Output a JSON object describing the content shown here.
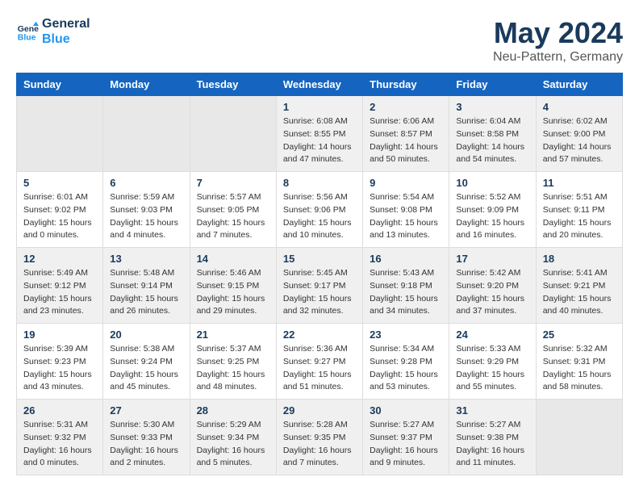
{
  "logo": {
    "line1": "General",
    "line2": "Blue"
  },
  "title": "May 2024",
  "location": "Neu-Pattern, Germany",
  "weekdays": [
    "Sunday",
    "Monday",
    "Tuesday",
    "Wednesday",
    "Thursday",
    "Friday",
    "Saturday"
  ],
  "weeks": [
    [
      {
        "day": "",
        "sunrise": "",
        "sunset": "",
        "daylight": ""
      },
      {
        "day": "",
        "sunrise": "",
        "sunset": "",
        "daylight": ""
      },
      {
        "day": "",
        "sunrise": "",
        "sunset": "",
        "daylight": ""
      },
      {
        "day": "1",
        "sunrise": "Sunrise: 6:08 AM",
        "sunset": "Sunset: 8:55 PM",
        "daylight": "Daylight: 14 hours and 47 minutes."
      },
      {
        "day": "2",
        "sunrise": "Sunrise: 6:06 AM",
        "sunset": "Sunset: 8:57 PM",
        "daylight": "Daylight: 14 hours and 50 minutes."
      },
      {
        "day": "3",
        "sunrise": "Sunrise: 6:04 AM",
        "sunset": "Sunset: 8:58 PM",
        "daylight": "Daylight: 14 hours and 54 minutes."
      },
      {
        "day": "4",
        "sunrise": "Sunrise: 6:02 AM",
        "sunset": "Sunset: 9:00 PM",
        "daylight": "Daylight: 14 hours and 57 minutes."
      }
    ],
    [
      {
        "day": "5",
        "sunrise": "Sunrise: 6:01 AM",
        "sunset": "Sunset: 9:02 PM",
        "daylight": "Daylight: 15 hours and 0 minutes."
      },
      {
        "day": "6",
        "sunrise": "Sunrise: 5:59 AM",
        "sunset": "Sunset: 9:03 PM",
        "daylight": "Daylight: 15 hours and 4 minutes."
      },
      {
        "day": "7",
        "sunrise": "Sunrise: 5:57 AM",
        "sunset": "Sunset: 9:05 PM",
        "daylight": "Daylight: 15 hours and 7 minutes."
      },
      {
        "day": "8",
        "sunrise": "Sunrise: 5:56 AM",
        "sunset": "Sunset: 9:06 PM",
        "daylight": "Daylight: 15 hours and 10 minutes."
      },
      {
        "day": "9",
        "sunrise": "Sunrise: 5:54 AM",
        "sunset": "Sunset: 9:08 PM",
        "daylight": "Daylight: 15 hours and 13 minutes."
      },
      {
        "day": "10",
        "sunrise": "Sunrise: 5:52 AM",
        "sunset": "Sunset: 9:09 PM",
        "daylight": "Daylight: 15 hours and 16 minutes."
      },
      {
        "day": "11",
        "sunrise": "Sunrise: 5:51 AM",
        "sunset": "Sunset: 9:11 PM",
        "daylight": "Daylight: 15 hours and 20 minutes."
      }
    ],
    [
      {
        "day": "12",
        "sunrise": "Sunrise: 5:49 AM",
        "sunset": "Sunset: 9:12 PM",
        "daylight": "Daylight: 15 hours and 23 minutes."
      },
      {
        "day": "13",
        "sunrise": "Sunrise: 5:48 AM",
        "sunset": "Sunset: 9:14 PM",
        "daylight": "Daylight: 15 hours and 26 minutes."
      },
      {
        "day": "14",
        "sunrise": "Sunrise: 5:46 AM",
        "sunset": "Sunset: 9:15 PM",
        "daylight": "Daylight: 15 hours and 29 minutes."
      },
      {
        "day": "15",
        "sunrise": "Sunrise: 5:45 AM",
        "sunset": "Sunset: 9:17 PM",
        "daylight": "Daylight: 15 hours and 32 minutes."
      },
      {
        "day": "16",
        "sunrise": "Sunrise: 5:43 AM",
        "sunset": "Sunset: 9:18 PM",
        "daylight": "Daylight: 15 hours and 34 minutes."
      },
      {
        "day": "17",
        "sunrise": "Sunrise: 5:42 AM",
        "sunset": "Sunset: 9:20 PM",
        "daylight": "Daylight: 15 hours and 37 minutes."
      },
      {
        "day": "18",
        "sunrise": "Sunrise: 5:41 AM",
        "sunset": "Sunset: 9:21 PM",
        "daylight": "Daylight: 15 hours and 40 minutes."
      }
    ],
    [
      {
        "day": "19",
        "sunrise": "Sunrise: 5:39 AM",
        "sunset": "Sunset: 9:23 PM",
        "daylight": "Daylight: 15 hours and 43 minutes."
      },
      {
        "day": "20",
        "sunrise": "Sunrise: 5:38 AM",
        "sunset": "Sunset: 9:24 PM",
        "daylight": "Daylight: 15 hours and 45 minutes."
      },
      {
        "day": "21",
        "sunrise": "Sunrise: 5:37 AM",
        "sunset": "Sunset: 9:25 PM",
        "daylight": "Daylight: 15 hours and 48 minutes."
      },
      {
        "day": "22",
        "sunrise": "Sunrise: 5:36 AM",
        "sunset": "Sunset: 9:27 PM",
        "daylight": "Daylight: 15 hours and 51 minutes."
      },
      {
        "day": "23",
        "sunrise": "Sunrise: 5:34 AM",
        "sunset": "Sunset: 9:28 PM",
        "daylight": "Daylight: 15 hours and 53 minutes."
      },
      {
        "day": "24",
        "sunrise": "Sunrise: 5:33 AM",
        "sunset": "Sunset: 9:29 PM",
        "daylight": "Daylight: 15 hours and 55 minutes."
      },
      {
        "day": "25",
        "sunrise": "Sunrise: 5:32 AM",
        "sunset": "Sunset: 9:31 PM",
        "daylight": "Daylight: 15 hours and 58 minutes."
      }
    ],
    [
      {
        "day": "26",
        "sunrise": "Sunrise: 5:31 AM",
        "sunset": "Sunset: 9:32 PM",
        "daylight": "Daylight: 16 hours and 0 minutes."
      },
      {
        "day": "27",
        "sunrise": "Sunrise: 5:30 AM",
        "sunset": "Sunset: 9:33 PM",
        "daylight": "Daylight: 16 hours and 2 minutes."
      },
      {
        "day": "28",
        "sunrise": "Sunrise: 5:29 AM",
        "sunset": "Sunset: 9:34 PM",
        "daylight": "Daylight: 16 hours and 5 minutes."
      },
      {
        "day": "29",
        "sunrise": "Sunrise: 5:28 AM",
        "sunset": "Sunset: 9:35 PM",
        "daylight": "Daylight: 16 hours and 7 minutes."
      },
      {
        "day": "30",
        "sunrise": "Sunrise: 5:27 AM",
        "sunset": "Sunset: 9:37 PM",
        "daylight": "Daylight: 16 hours and 9 minutes."
      },
      {
        "day": "31",
        "sunrise": "Sunrise: 5:27 AM",
        "sunset": "Sunset: 9:38 PM",
        "daylight": "Daylight: 16 hours and 11 minutes."
      },
      {
        "day": "",
        "sunrise": "",
        "sunset": "",
        "daylight": ""
      }
    ]
  ]
}
